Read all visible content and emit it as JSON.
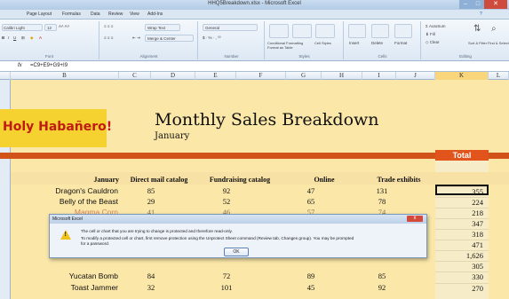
{
  "window": {
    "title": "HHQ5Breakdown.xlsx - Microsoft Excel"
  },
  "ribbon_tabs": [
    "Page Layout",
    "Formulas",
    "Data",
    "Review",
    "View",
    "Add-Ins"
  ],
  "ribbon": {
    "font_name": "Calibri Light",
    "font_size": "12",
    "groups": {
      "font": "Font",
      "alignment": "Alignment",
      "number": "Number",
      "styles": "Styles",
      "cells": "Cells",
      "editing": "Editing"
    },
    "wrap_text": "Wrap Text",
    "merge_center": "Merge & Center",
    "number_format": "General",
    "conditional": "Conditional Formatting",
    "format_table": "Format as Table",
    "cell_styles": "Cell Styles",
    "insert": "Insert",
    "delete": "Delete",
    "format": "Format",
    "autosum": "AutoSum",
    "fill": "Fill",
    "clear": "Clear",
    "sort": "Sort & Filter",
    "find": "Find & Select"
  },
  "formula_bar": {
    "fx": "fx",
    "formula": "=C9+E9+G9+I9"
  },
  "columns": [
    "B",
    "C",
    "D",
    "E",
    "F",
    "G",
    "H",
    "I",
    "J",
    "K",
    "L"
  ],
  "sheet": {
    "logo": "Holy Habañero!",
    "title": "Monthly Sales Breakdown",
    "subtitle": "January",
    "total_header": "Total",
    "headers": [
      "January",
      "Direct mail catalog",
      "Fundraising catalog",
      "Online",
      "Trade exhibits"
    ],
    "rows": [
      {
        "name": "Dragon's Cauldron",
        "c": "85",
        "e": "92",
        "g": "47",
        "i": "131"
      },
      {
        "name": "Belly of the Beast",
        "c": "29",
        "e": "52",
        "g": "65",
        "i": "78"
      },
      {
        "name": "Magma Corn",
        "c": "41",
        "e": "46",
        "g": "57",
        "i": "74"
      },
      {
        "name": "Yucatan Bomb",
        "c": "84",
        "e": "72",
        "g": "89",
        "i": "85"
      },
      {
        "name": "Toast Jammer",
        "c": "32",
        "e": "101",
        "g": "45",
        "i": "92"
      }
    ],
    "totals": [
      "355",
      "224",
      "218",
      "347",
      "318",
      "471",
      "1,626",
      "305",
      "330",
      "270"
    ]
  },
  "dialog": {
    "title": "Microsoft Excel",
    "line1": "The cell or chart that you are trying to change is protected and therefore read-only.",
    "line2": "To modify a protected cell or chart, first remove protection using the Unprotect Sheet command (Review tab, Changes group). You may be prompted",
    "line3": "for a password.",
    "ok": "OK",
    "close": "x"
  },
  "colors": {
    "accent_orange": "#e1541c",
    "logo_bg": "#f6d230",
    "logo_text": "#c01b12",
    "sheet_bg": "#fbe7a8"
  }
}
